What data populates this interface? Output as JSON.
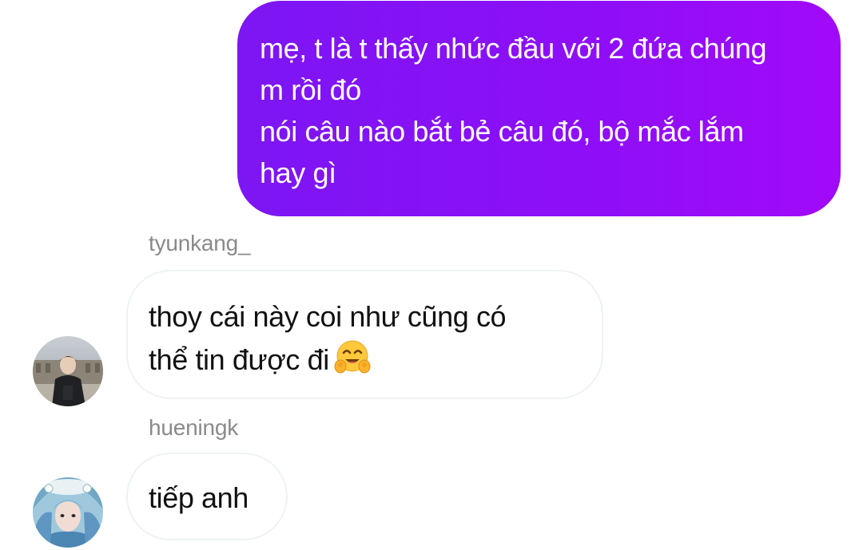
{
  "messages": {
    "outgoing": {
      "lines": [
        "mẹ, t là t thấy nhức đầu với 2 đứa chúng",
        "m rồi đó",
        "nói câu nào bắt bẻ câu đó, bộ mắc lắm",
        "hay gì"
      ]
    },
    "incoming_1": {
      "sender": "tyunkang_",
      "lines": [
        "thoy cái này coi như cũng có",
        "thể tin được đi"
      ],
      "emoji": "hugging-face-emoji"
    },
    "incoming_2": {
      "sender": "hueningk",
      "text": "tiếp anh"
    }
  },
  "colors": {
    "outgoing_bubble_start": "#7c16f3",
    "outgoing_bubble_end": "#a10af8",
    "incoming_bubble_border": "#eef2f4",
    "sender_label": "#8a8a8a"
  }
}
